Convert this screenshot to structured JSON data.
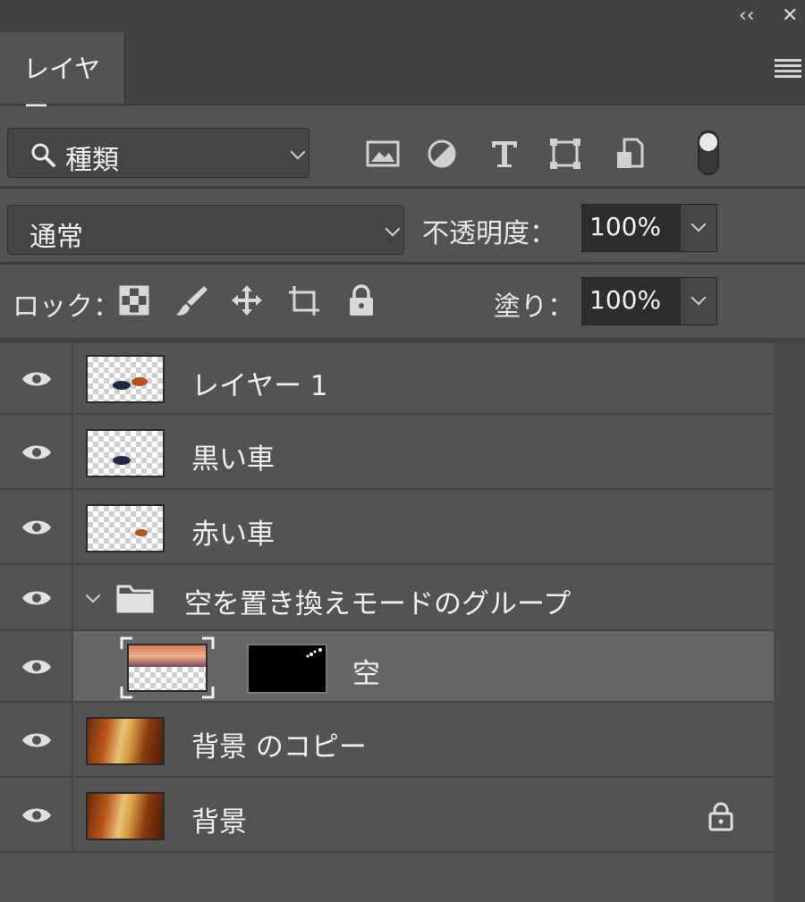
{
  "panel": {
    "collapse_glyph": "‹‹",
    "close_glyph": "✕",
    "tab_label": "レイヤー",
    "menu_icon": "hamburger-menu-icon"
  },
  "filter": {
    "search_icon": "search-icon",
    "kind_label": "種類",
    "filter_icons": [
      "image-filter-icon",
      "adjustment-filter-icon",
      "text-filter-icon",
      "shape-filter-icon",
      "smart-object-filter-icon"
    ]
  },
  "blend": {
    "mode": "通常",
    "opacity_label": "不透明度：",
    "opacity_value": "100%"
  },
  "lock": {
    "label": "ロック：",
    "icons": [
      "lock-transparent-pixels-icon",
      "lock-image-pixels-icon",
      "lock-position-icon",
      "lock-artboard-icon",
      "lock-all-icon"
    ],
    "fill_label": "塗り：",
    "fill_value": "100%"
  },
  "layers": [
    {
      "name": "レイヤー 1",
      "visible": true,
      "thumb": "transparent-two-cars"
    },
    {
      "name": "黒い車",
      "visible": true,
      "thumb": "transparent-black-car"
    },
    {
      "name": "赤い車",
      "visible": true,
      "thumb": "transparent-red-car"
    },
    {
      "name": "空を置き換えモードのグループ",
      "visible": true,
      "type": "group",
      "expanded": true
    },
    {
      "name": "空",
      "visible": true,
      "selected": true,
      "thumb": "sky",
      "mask": true
    },
    {
      "name": "背景 のコピー",
      "visible": true,
      "thumb": "autumn-forest"
    },
    {
      "name": "背景",
      "visible": true,
      "thumb": "autumn-forest",
      "locked": true
    }
  ],
  "colors": {
    "panel_bg": "#535353",
    "header_bg": "#424242",
    "selected_row": "#666666",
    "field_bg": "#2d2d2d"
  }
}
